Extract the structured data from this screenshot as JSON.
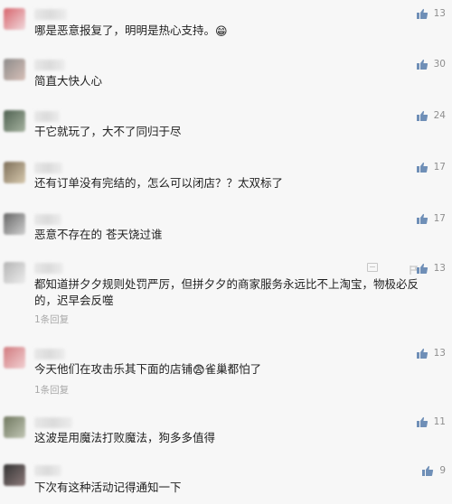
{
  "comments": [
    {
      "text": "哪是恶意报复了，明明是热心支持。",
      "emoji": "😁",
      "likes": "13",
      "avatar_colors": [
        "#d7656d",
        "#f1d9dc"
      ]
    },
    {
      "text": "简直大快人心",
      "likes": "30",
      "avatar_colors": [
        "#8d8b8a",
        "#d7c0b8"
      ]
    },
    {
      "text": "干它就玩了，大不了同归于尽",
      "likes": "24",
      "avatar_colors": [
        "#4f6151",
        "#a6b3a0"
      ]
    },
    {
      "text": "还有订单没有完结的，怎么可以闭店？？太双标了",
      "likes": "17",
      "avatar_colors": [
        "#7e6f59",
        "#d7c9ae"
      ]
    },
    {
      "text": "恶意不存在的 苍天饶过谁",
      "likes": "17",
      "avatar_colors": [
        "#666",
        "#d0d0d0"
      ]
    },
    {
      "text": "都知道拼夕夕规则处罚严厉，但拼夕夕的商家服务永远比不上淘宝，物极必反的，迟早会反噬",
      "likes": "13",
      "meta": "1条回复",
      "avatar_colors": [
        "#b4b4b4",
        "#ededed"
      ]
    },
    {
      "text": "今天他们在攻击乐其下面的店铺",
      "emoji": "😨",
      "text_after": "雀巢都怕了",
      "likes": "13",
      "meta": "1条回复",
      "avatar_colors": [
        "#d17b7f",
        "#f2d0d2"
      ]
    },
    {
      "text": "这波是用魔法打败魔法，狗多多值得",
      "likes": "11",
      "avatar_colors": [
        "#707860",
        "#c1c6b4"
      ]
    },
    {
      "text": "下次有这种活动记得通知一下",
      "likes": "9",
      "avatar_colors": [
        "#333333",
        "#8c7a7a"
      ]
    }
  ],
  "icons": {
    "thumbs_up": "thumbs-up-icon",
    "reply": "reply-icon",
    "report": "report-icon"
  },
  "colors": {
    "background": "#f7f7f7",
    "text": "#1f1f1f",
    "muted": "#a9a9a9",
    "accent": "#6f8fb7"
  }
}
